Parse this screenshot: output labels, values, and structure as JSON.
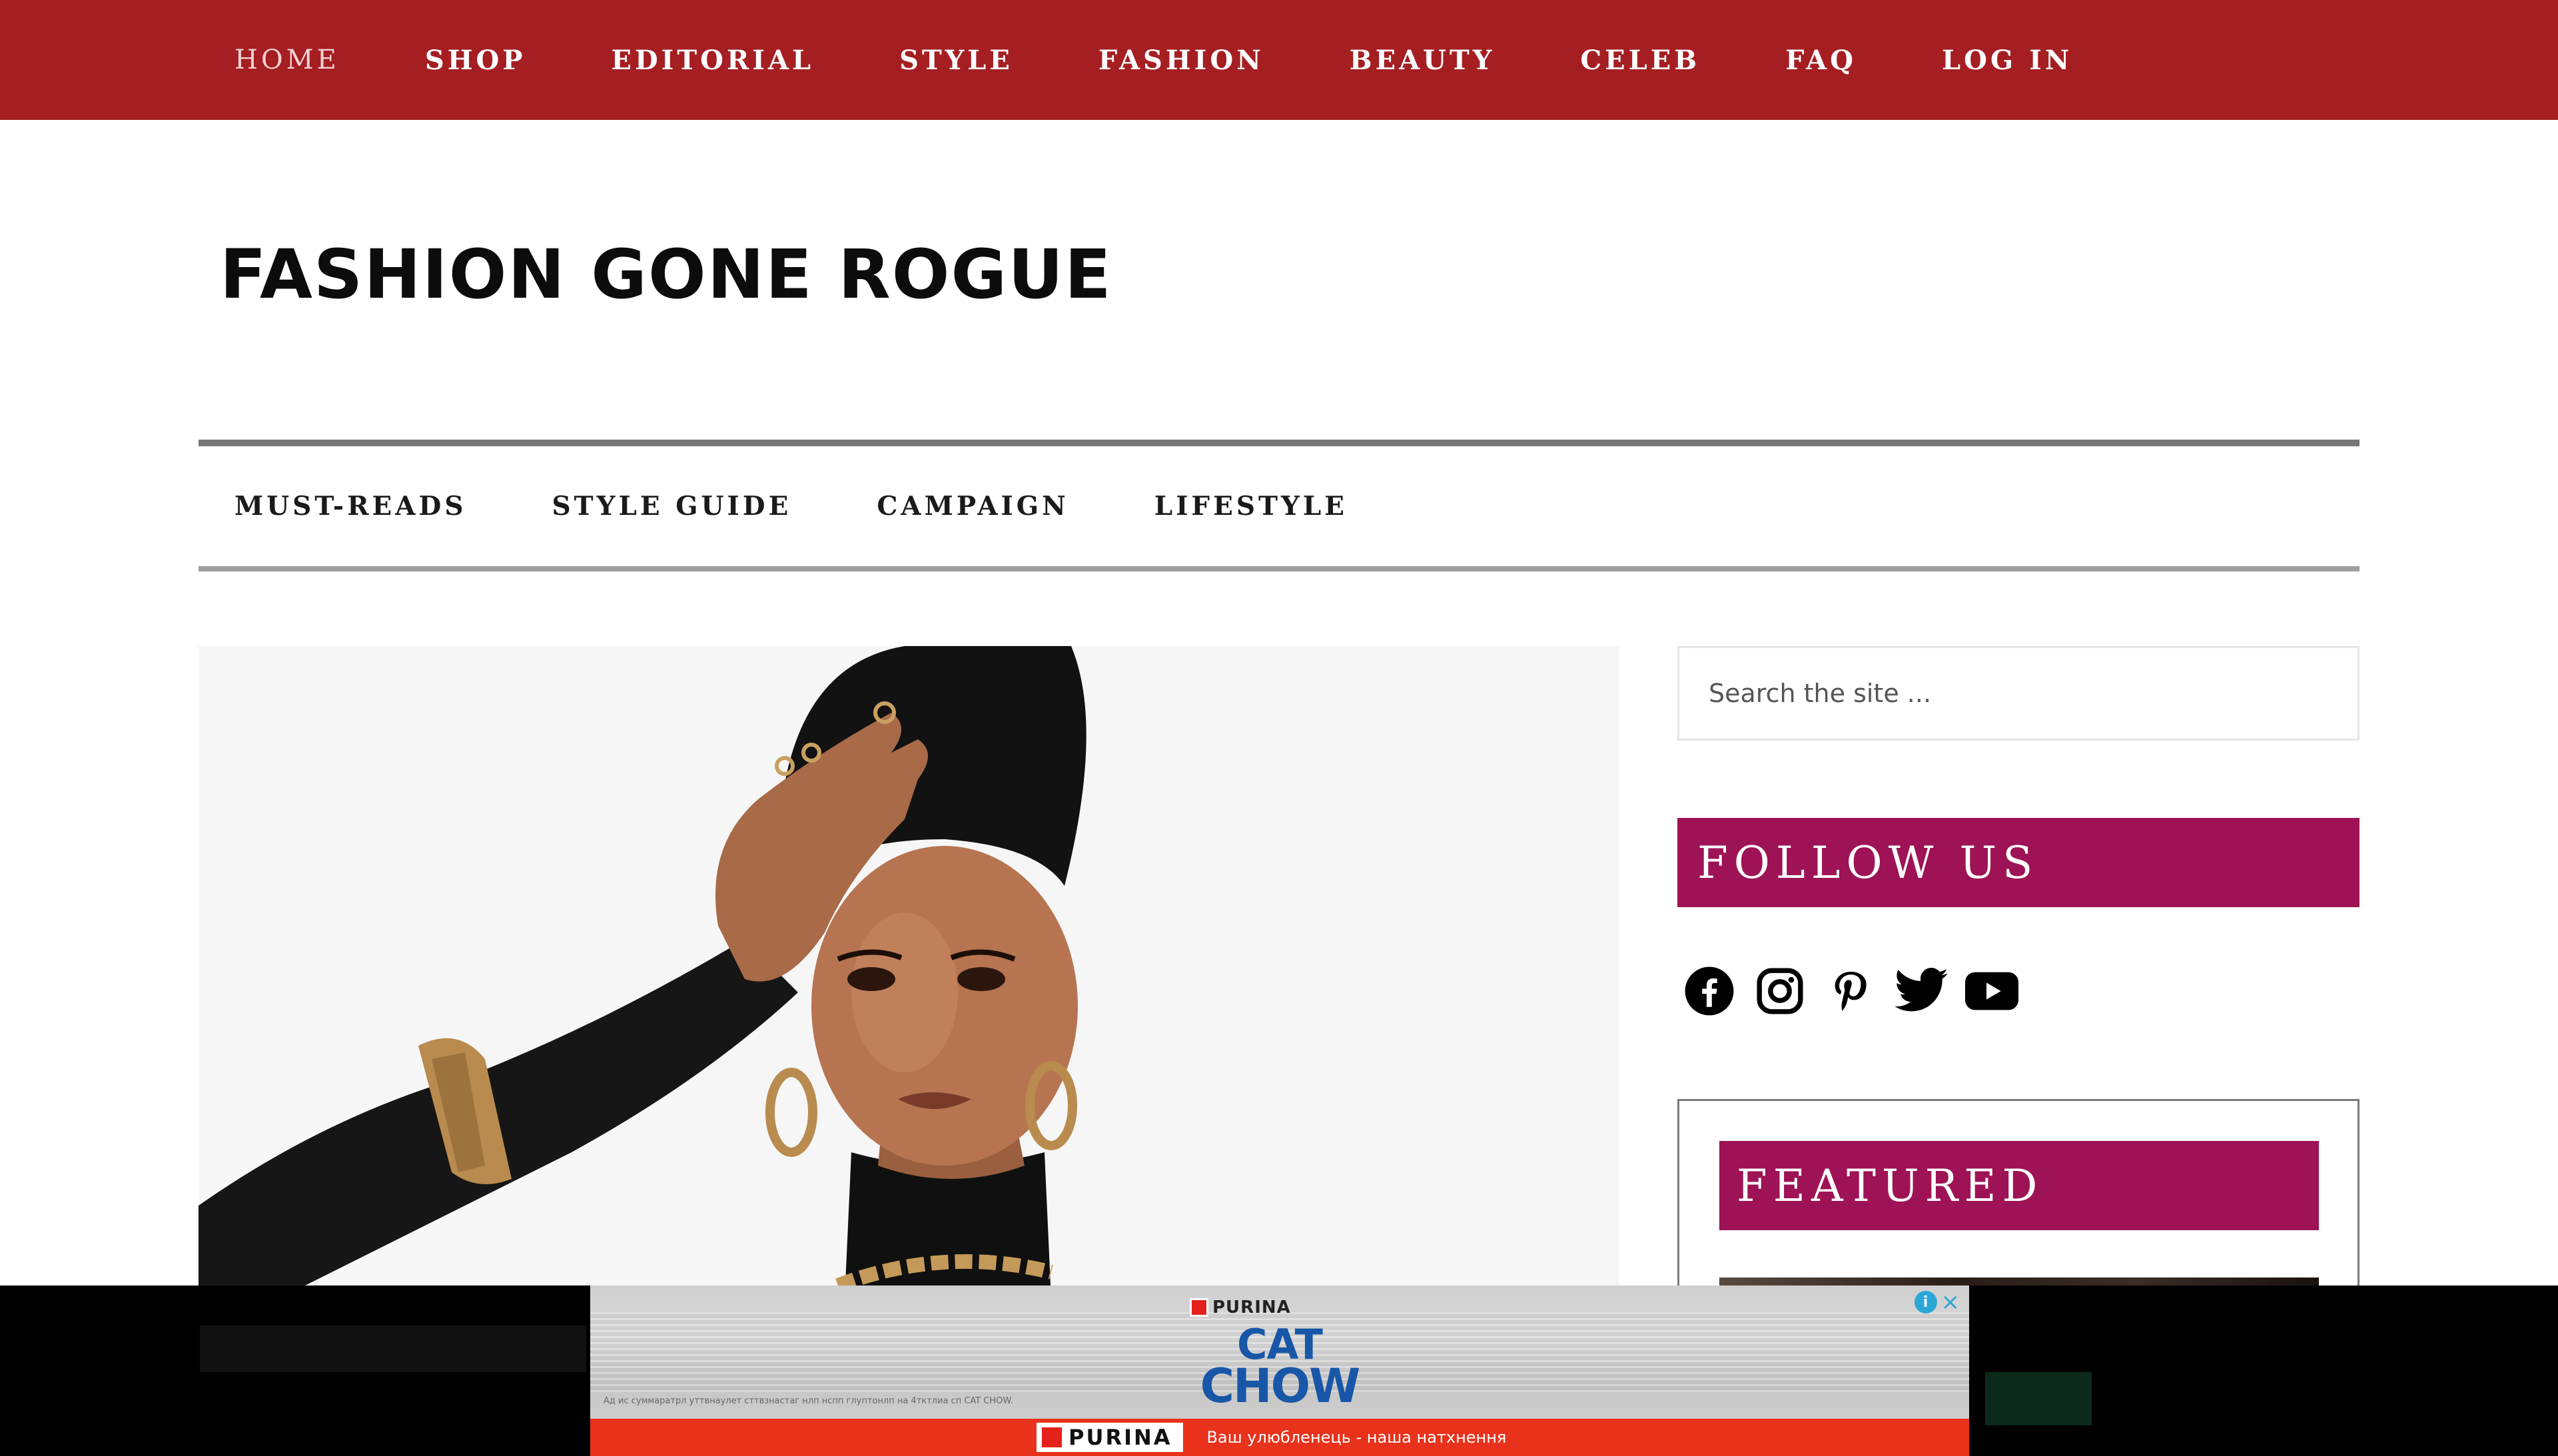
{
  "top_nav": {
    "items": [
      {
        "label": "HOME",
        "active": true
      },
      {
        "label": "SHOP"
      },
      {
        "label": "EDITORIAL"
      },
      {
        "label": "STYLE"
      },
      {
        "label": "FASHION"
      },
      {
        "label": "BEAUTY"
      },
      {
        "label": "CELEB"
      },
      {
        "label": "FAQ"
      },
      {
        "label": "LOG IN"
      }
    ]
  },
  "site": {
    "title": "FASHION GONE ROGUE"
  },
  "sub_nav": {
    "items": [
      {
        "label": "MUST-READS"
      },
      {
        "label": "STYLE GUIDE"
      },
      {
        "label": "CAMPAIGN"
      },
      {
        "label": "LIFESTYLE"
      }
    ]
  },
  "sidebar": {
    "search": {
      "placeholder": "Search the site ..."
    },
    "follow": {
      "title": "FOLLOW US"
    },
    "social": [
      {
        "icon": "facebook-icon"
      },
      {
        "icon": "instagram-icon"
      },
      {
        "icon": "pinterest-icon"
      },
      {
        "icon": "twitter-icon"
      },
      {
        "icon": "youtube-icon"
      }
    ],
    "featured": {
      "title": "FEATURED"
    }
  },
  "ad": {
    "brand_top": "PURINA",
    "product_line1": "CAT",
    "product_line2": "CHOW",
    "fine_print": "Ад ис суммаратрл уттвнаулет сттвзнастаг нлп нспп глуптонлп на 4тктлиа сп CAT CHOW.",
    "brand_bottom": "PURINA",
    "tagline": "Ваш улюбленець - наша натхнення"
  },
  "colors": {
    "topbar": "#a51e22",
    "accent_band": "#9e1355",
    "ad_red": "#e8321c",
    "ad_blue": "#1856a8"
  }
}
